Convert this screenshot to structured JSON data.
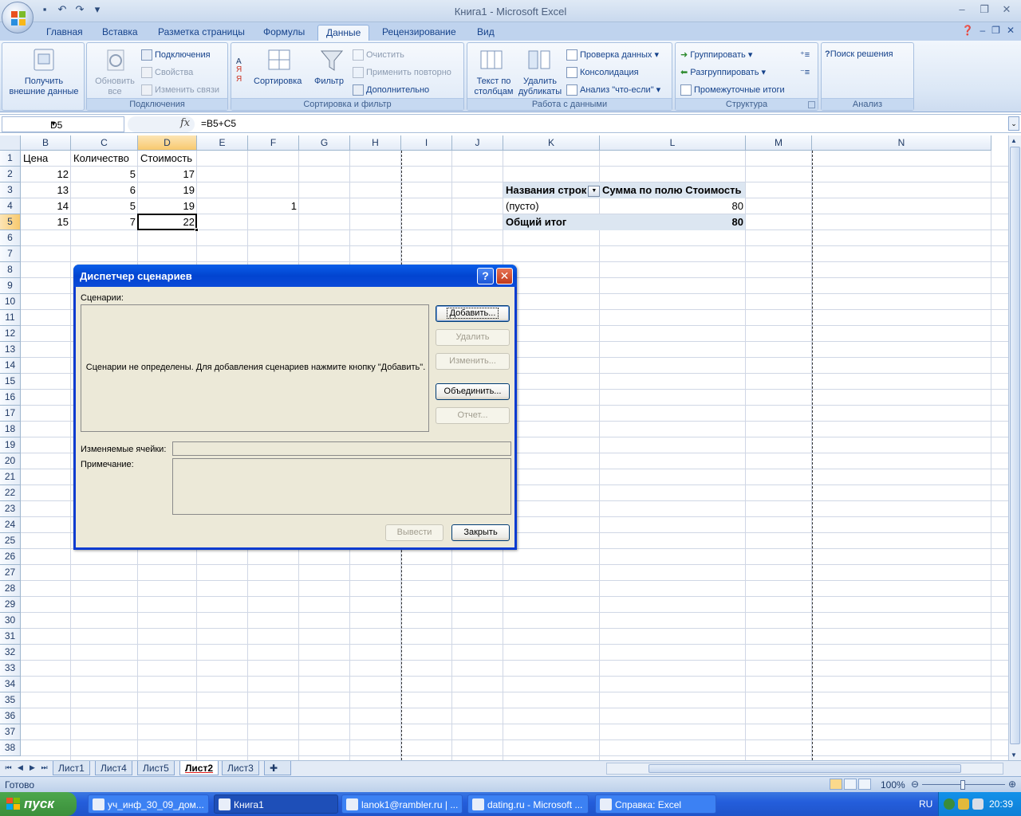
{
  "window": {
    "title": "Книга1 - Microsoft Excel",
    "controls": [
      "–",
      "❐",
      "✕"
    ],
    "inner_controls": [
      "–",
      "❐",
      "✕"
    ]
  },
  "ribbon": {
    "tabs": [
      "Главная",
      "Вставка",
      "Разметка страницы",
      "Формулы",
      "Данные",
      "Рецензирование",
      "Вид"
    ],
    "active_tab": "Данные",
    "groups": {
      "connections": {
        "label": "Подключения",
        "get_external": "Получить внешние данные",
        "refresh_all": "Обновить все",
        "connections": "Подключения",
        "properties": "Свойства",
        "edit_links": "Изменить связи"
      },
      "sort_filter": {
        "label": "Сортировка и фильтр",
        "sort": "Сортировка",
        "filter": "Фильтр",
        "clear": "Очистить",
        "reapply": "Применить повторно",
        "advanced": "Дополнительно"
      },
      "data_tools": {
        "label": "Работа с данными",
        "text_to_columns": "Текст по столбцам",
        "remove_duplicates": "Удалить дубликаты",
        "validation": "Проверка данных",
        "consolidate": "Консолидация",
        "what_if": "Анализ \"что-если\""
      },
      "outline": {
        "label": "Структура",
        "group": "Группировать",
        "ungroup": "Разгруппировать",
        "subtotal": "Промежуточные итоги"
      },
      "analysis": {
        "label": "Анализ",
        "solver": "Поиск решения"
      }
    }
  },
  "formula_bar": {
    "name_box": "D5",
    "fx": "fx",
    "formula": "=B5+C5"
  },
  "sheet": {
    "columns": [
      "B",
      "C",
      "D",
      "E",
      "F",
      "G",
      "H",
      "I",
      "J",
      "K",
      "L",
      "M",
      "N"
    ],
    "selected_column": "D",
    "selected_row": "5",
    "rows": [
      "1",
      "2",
      "3",
      "4",
      "5",
      "6",
      "7",
      "8",
      "9",
      "10",
      "11",
      "12",
      "13",
      "14",
      "15",
      "16",
      "17",
      "18",
      "19",
      "20",
      "21",
      "22",
      "23",
      "24",
      "25",
      "26",
      "27",
      "28",
      "29",
      "30",
      "31",
      "32",
      "33",
      "34",
      "35",
      "36",
      "37",
      "38"
    ],
    "headers": {
      "b": "Цена",
      "c": "Количество",
      "d": "Стоимость"
    },
    "data": [
      {
        "b": "12",
        "c": "5",
        "d": "17"
      },
      {
        "b": "13",
        "c": "6",
        "d": "19"
      },
      {
        "b": "14",
        "c": "5",
        "d": "19"
      },
      {
        "b": "15",
        "c": "7",
        "d": "22"
      }
    ],
    "f4": "1",
    "pivot": {
      "row_label": "Названия строк",
      "value_label": "Сумма по полю Стоимость",
      "empty_label": "(пусто)",
      "empty_value": "80",
      "total_label": "Общий итог",
      "total_value": "80"
    }
  },
  "sheet_tabs": [
    "Лист1",
    "Лист4",
    "Лист5",
    "Лист2",
    "Лист3"
  ],
  "active_sheet": "Лист2",
  "status": {
    "ready": "Готово",
    "zoom": "100%"
  },
  "dialog": {
    "title": "Диспетчер сценариев",
    "help": "?",
    "close": "✕",
    "scenarios_label": "Сценарии:",
    "empty_message": "Сценарии не определены. Для добавления сценариев нажмите кнопку \"Добавить\".",
    "add": "Добавить...",
    "delete": "Удалить",
    "edit": "Изменить...",
    "merge": "Объединить...",
    "report": "Отчет...",
    "changing_cells_label": "Изменяемые ячейки:",
    "comment_label": "Примечание:",
    "show": "Вывести",
    "close_button": "Закрыть"
  },
  "taskbar": {
    "start": "пуск",
    "tasks": [
      "уч_инф_30_09_дом...",
      "Книга1",
      "lanok1@rambler.ru | ...",
      "dating.ru - Microsoft ...",
      "Справка: Excel"
    ],
    "active_task": "Книга1",
    "lang": "RU",
    "clock": "20:39"
  }
}
